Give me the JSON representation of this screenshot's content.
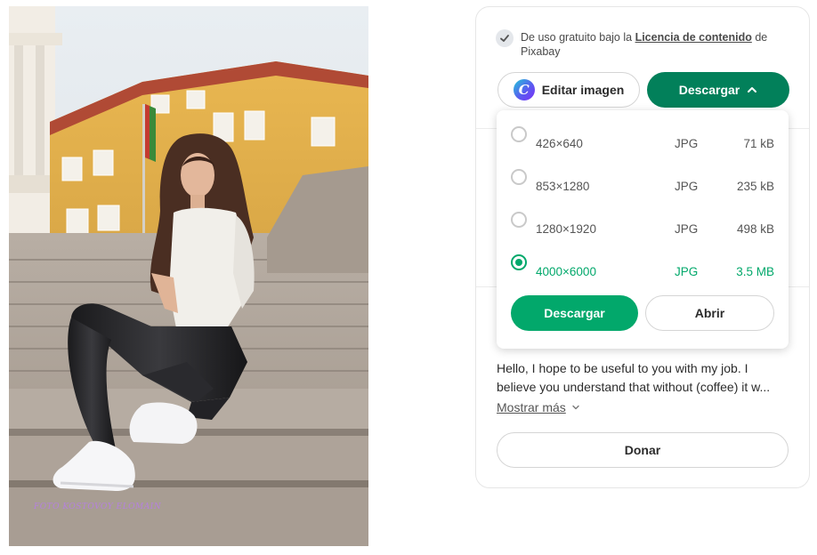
{
  "photo": {
    "watermark": "FOTO KOSTOVOY ELOMAIN"
  },
  "license": {
    "prefix": "De uso gratuito bajo la ",
    "link": "Licencia de contenido",
    "suffix": " de Pixabay"
  },
  "actions": {
    "edit_label": "Editar imagen",
    "canva_letter": "C",
    "download_label": "Descargar"
  },
  "download_menu": {
    "options": [
      {
        "resolution": "426×640",
        "format": "JPG",
        "size": "71 kB",
        "selected": false
      },
      {
        "resolution": "853×1280",
        "format": "JPG",
        "size": "235 kB",
        "selected": false
      },
      {
        "resolution": "1280×1920",
        "format": "JPG",
        "size": "498 kB",
        "selected": false
      },
      {
        "resolution": "4000×6000",
        "format": "JPG",
        "size": "3.5 MB",
        "selected": true
      }
    ],
    "download_button": "Descargar",
    "open_button": "Abrir"
  },
  "description": {
    "line1": "Hello, I hope to be useful to you with my job. I",
    "line2": "believe you understand that without (coffee) it w...",
    "more_label": "Mostrar más"
  },
  "donate": {
    "label": "Donar"
  },
  "colors": {
    "primary_dark": "#02805a",
    "primary": "#02a86b"
  }
}
